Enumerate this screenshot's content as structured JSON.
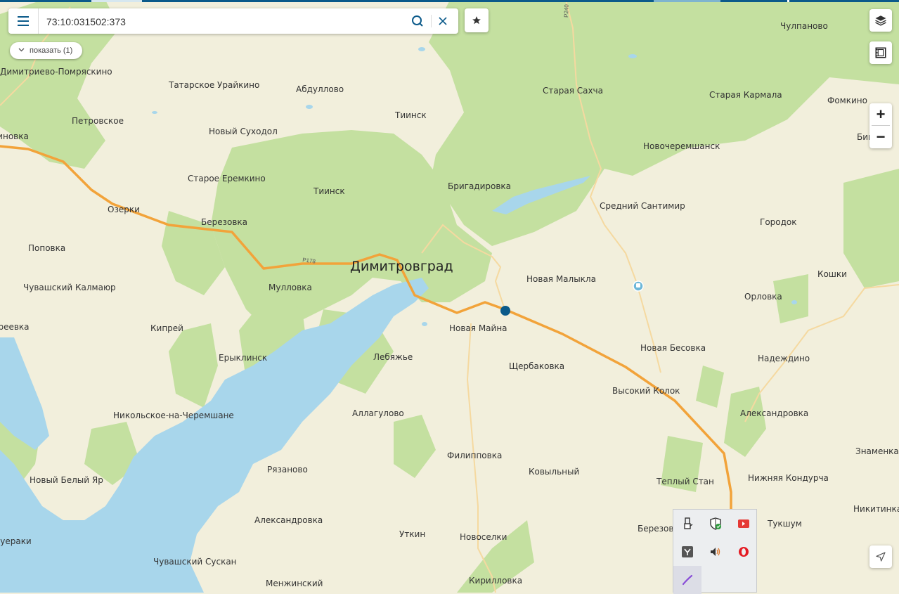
{
  "search": {
    "value": "73:10:031502:373"
  },
  "show_toggle": {
    "label": "показать (1)"
  },
  "zoom": {
    "in_label": "+",
    "out_label": "−"
  },
  "colors": {
    "water": "#a8d6eb",
    "forest": "#c4e0a0",
    "land": "#f2efdc",
    "road_major": "#f2a33a",
    "road_minor": "#f5d9a0",
    "marker": "#0b5a8a",
    "header_bar": "#0b5a8a"
  },
  "map": {
    "city": "Димитровград",
    "road_labels": [
      "Р178",
      "Р240"
    ],
    "places": [
      "Чулпаново",
      "Димитриево-Помряскино",
      "Татарское Урайкино",
      "Абдуллово",
      "Старая Сахча",
      "Старая Кармала",
      "Фомкино",
      "Тиинск",
      "Петровское",
      "Новый Суходол",
      "Бик",
      "Новочеремшанск",
      "Екатериновка",
      "Старое Еремкино",
      "Тиинск",
      "Бригадировка",
      "Озерки",
      "Березовка",
      "Средний Сантимир",
      "Городок",
      "Поповка",
      "Новая Малыкла",
      "Кошки",
      "Чувашский Калмаюр",
      "Мулловка",
      "Орловка",
      "Новая Майна",
      "Ореевка",
      "Кипрей",
      "Новая Бесовка",
      "Надеждино",
      "Ерыклинск",
      "Лебяжье",
      "Щербаковка",
      "Высокий Колок",
      "Никольское-на-Черемшане",
      "Аллагулово",
      "Александровка",
      "Знаменка",
      "Филипповка",
      "Ковыльный",
      "Рязаново",
      "Новый Белый Яр",
      "Теплый Стан",
      "Нижняя Кондурча",
      "Никитинка",
      "Александровка",
      "Березовка",
      "Тукшум",
      "Буераки",
      "Уткин",
      "Новоселки",
      "Чувашский Сускан",
      "Менжинский",
      "Кирилловка"
    ]
  },
  "tray_icons": [
    "usb-device-icon",
    "defender-shield-icon",
    "screen-record-icon",
    "yandex-icon",
    "volume-icon",
    "opera-icon",
    "pen-icon"
  ]
}
